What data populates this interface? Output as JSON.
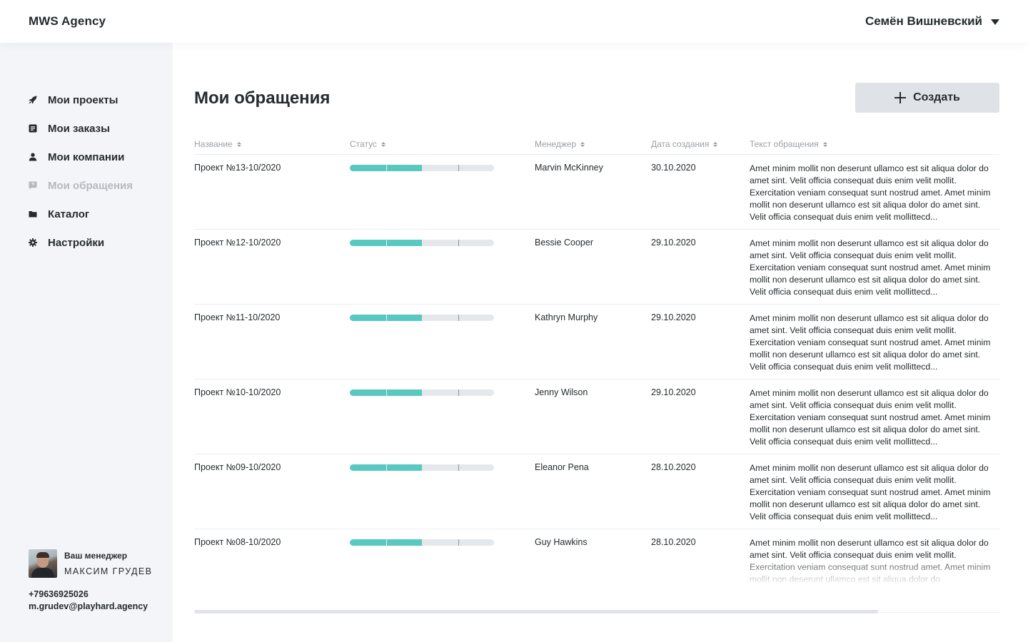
{
  "app": {
    "brand": "MWS Agency",
    "user_name": "Семён Вишневский"
  },
  "sidebar": {
    "items": [
      {
        "label": "Мои проекты",
        "icon": "rocket-icon",
        "disabled": false
      },
      {
        "label": "Мои заказы",
        "icon": "document-icon",
        "disabled": false
      },
      {
        "label": "Мои компании",
        "icon": "user-icon",
        "disabled": false
      },
      {
        "label": "Мои обращения",
        "icon": "chat-question-icon",
        "disabled": true
      },
      {
        "label": "Каталог",
        "icon": "folder-icon",
        "disabled": false
      },
      {
        "label": "Настройки",
        "icon": "gear-icon",
        "disabled": false
      }
    ],
    "manager": {
      "caption": "Ваш менеджер",
      "name": "Максим Грудев",
      "phone": "+79636925026",
      "email": "m.grudev@playhard.agency"
    }
  },
  "main": {
    "title": "Мои обращения",
    "create_label": "Создать",
    "columns": [
      "Название",
      "Статус",
      "Менеджер",
      "Дата создания",
      "Текст обращения"
    ],
    "rows": [
      {
        "name": "Проект №13-10/2020",
        "progress": 0.5,
        "manager": "Marvin McKinney",
        "date": "30.10.2020",
        "text": "Amet minim mollit non deserunt ullamco est sit aliqua dolor do amet sint. Velit officia consequat duis enim velit mollit. Exercitation veniam consequat sunt nostrud amet. Amet minim mollit non deserunt ullamco est sit aliqua dolor do amet sint. Velit officia consequat duis enim velit mollittecd..."
      },
      {
        "name": "Проект №12-10/2020",
        "progress": 0.5,
        "manager": "Bessie Cooper",
        "date": "29.10.2020",
        "text": "Amet minim mollit non deserunt ullamco est sit aliqua dolor do amet sint. Velit officia consequat duis enim velit mollit. Exercitation veniam consequat sunt nostrud amet. Amet minim mollit non deserunt ullamco est sit aliqua dolor do amet sint. Velit officia consequat duis enim velit mollittecd..."
      },
      {
        "name": "Проект №11-10/2020",
        "progress": 0.5,
        "manager": "Kathryn Murphy",
        "date": "29.10.2020",
        "text": "Amet minim mollit non deserunt ullamco est sit aliqua dolor do amet sint. Velit officia consequat duis enim velit mollit. Exercitation veniam consequat sunt nostrud amet. Amet minim mollit non deserunt ullamco est sit aliqua dolor do amet sint. Velit officia consequat duis enim velit mollittecd..."
      },
      {
        "name": "Проект №10-10/2020",
        "progress": 0.5,
        "manager": "Jenny Wilson",
        "date": "29.10.2020",
        "text": "Amet minim mollit non deserunt ullamco est sit aliqua dolor do amet sint. Velit officia consequat duis enim velit mollit. Exercitation veniam consequat sunt nostrud amet. Amet minim mollit non deserunt ullamco est sit aliqua dolor do amet sint. Velit officia consequat duis enim velit mollittecd..."
      },
      {
        "name": "Проект №09-10/2020",
        "progress": 0.5,
        "manager": "Eleanor Pena",
        "date": "28.10.2020",
        "text": "Amet minim mollit non deserunt ullamco est sit aliqua dolor do amet sint. Velit officia consequat duis enim velit mollit. Exercitation veniam consequat sunt nostrud amet. Amet minim mollit non deserunt ullamco est sit aliqua dolor do amet sint. Velit officia consequat duis enim velit mollittecd..."
      },
      {
        "name": "Проект №08-10/2020",
        "progress": 0.5,
        "manager": "Guy Hawkins",
        "date": "28.10.2020",
        "text": "Amet minim mollit non deserunt ullamco est sit aliqua dolor do amet sint. Velit officia consequat duis enim velit mollit. Exercitation veniam consequat sunt nostrud amet. Amet minim mollit non deserunt ullamco est sit aliqua dolor do"
      }
    ]
  },
  "colors": {
    "progress_fill": "#58c8c1",
    "progress_track": "#e5e8eb",
    "sidebar_bg": "#f4f5f8",
    "button_bg": "#dfe2e6",
    "text": "#252b2e",
    "muted": "#9aa0a6"
  }
}
